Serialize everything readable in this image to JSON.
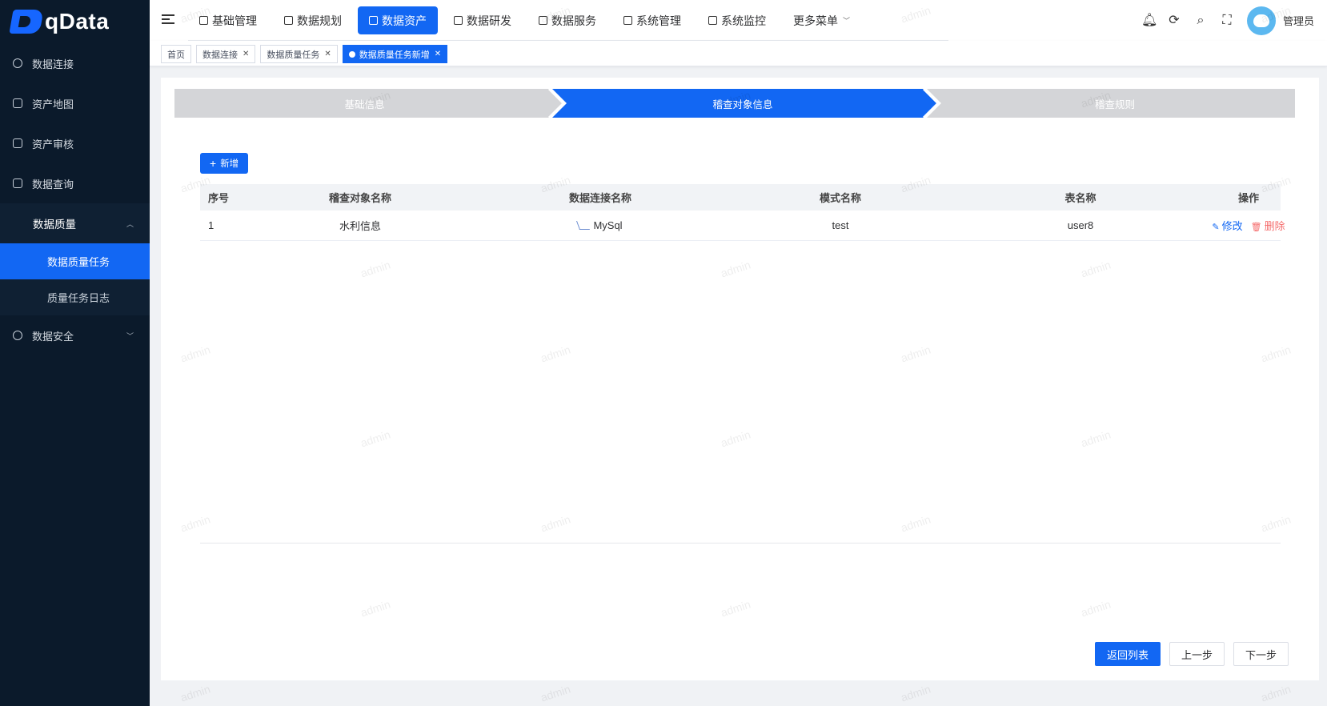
{
  "brand": {
    "name": "qData"
  },
  "sidebar": {
    "items": [
      {
        "label": "数据连接",
        "icon": "target-icon"
      },
      {
        "label": "资产地图",
        "icon": "map-icon"
      },
      {
        "label": "资产审核",
        "icon": "copy-icon"
      },
      {
        "label": "数据查询",
        "icon": "query-icon"
      }
    ],
    "open_group": {
      "label": "数据质量",
      "children": [
        {
          "label": "数据质量任务",
          "active": true
        },
        {
          "label": "质量任务日志",
          "active": false
        }
      ]
    },
    "bottom_item": {
      "label": "数据安全",
      "icon": "shield-icon"
    }
  },
  "topnav": {
    "items": [
      {
        "label": "基础管理",
        "active": false
      },
      {
        "label": "数据规划",
        "active": false
      },
      {
        "label": "数据资产",
        "active": true
      },
      {
        "label": "数据研发",
        "active": false
      },
      {
        "label": "数据服务",
        "active": false
      },
      {
        "label": "系统管理",
        "active": false
      },
      {
        "label": "系统监控",
        "active": false
      }
    ],
    "more_label": "更多菜单"
  },
  "header": {
    "username": "管理员"
  },
  "tags": [
    {
      "label": "首页",
      "closable": false,
      "active": false
    },
    {
      "label": "数据连接",
      "closable": true,
      "active": false
    },
    {
      "label": "数据质量任务",
      "closable": true,
      "active": false
    },
    {
      "label": "数据质量任务新增",
      "closable": true,
      "active": true
    }
  ],
  "steps": [
    {
      "label": "基础信息",
      "state": "done"
    },
    {
      "label": "稽查对象信息",
      "state": "active"
    },
    {
      "label": "稽查规则",
      "state": "todo"
    }
  ],
  "toolbar": {
    "add_label": "新增"
  },
  "table": {
    "columns": [
      "序号",
      "稽查对象名称",
      "数据连接名称",
      "模式名称",
      "表名称",
      "操作"
    ],
    "rows": [
      {
        "index": "1",
        "name": "水利信息",
        "connection": "MySql",
        "schema": "test",
        "table": "user8",
        "edit": "修改",
        "delete": "删除"
      }
    ]
  },
  "footer": {
    "back_label": "返回列表",
    "prev_label": "上一步",
    "next_label": "下一步"
  },
  "watermark": "admin",
  "colors": {
    "primary": "#1267f3",
    "sidebar": "#0b1a2b",
    "danger": "#f56c6c",
    "step_todo": "#d4d5d8"
  }
}
